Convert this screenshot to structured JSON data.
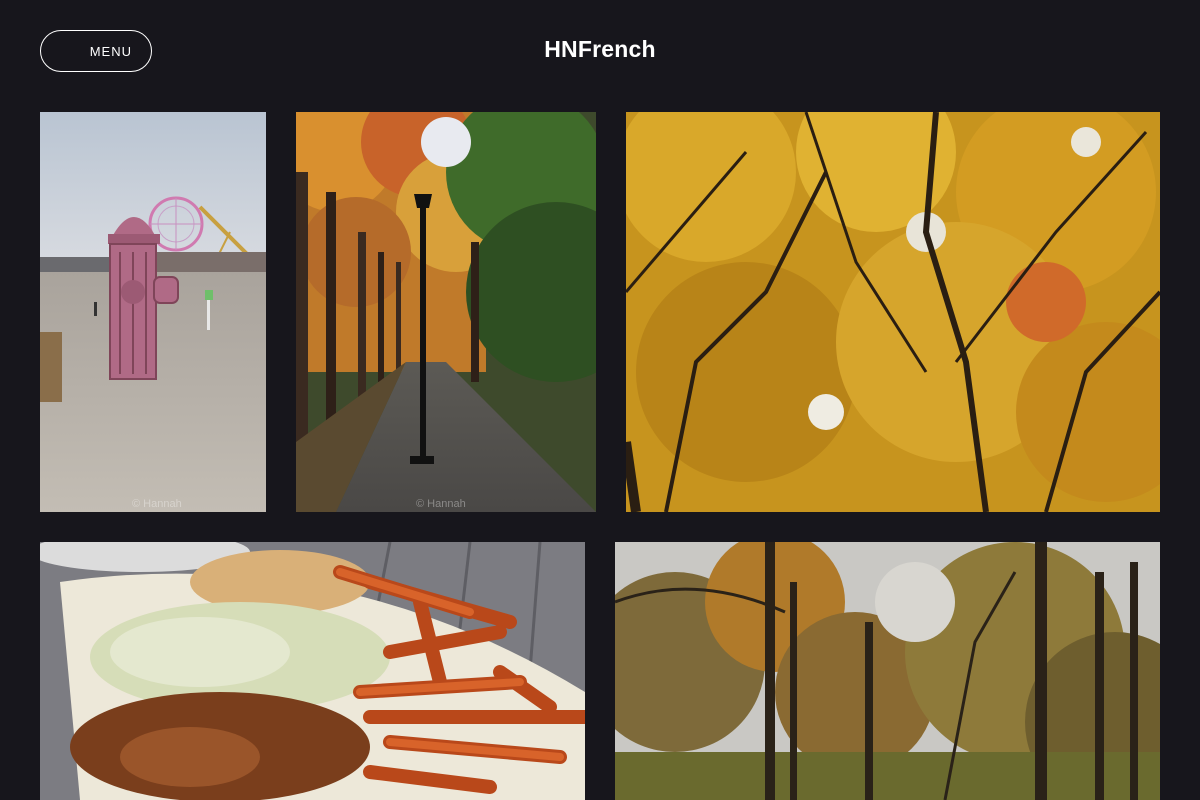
{
  "header": {
    "menu_label": "MENU",
    "site_title": "HNFrench"
  },
  "gallery": {
    "photos": [
      {
        "subject": "beach-fire-hydrant-ferris-wheel",
        "watermark": "© Hannah"
      },
      {
        "subject": "autumn-path-lamppost",
        "watermark": "© Hannah"
      },
      {
        "subject": "yellow-autumn-canopy",
        "watermark": ""
      },
      {
        "subject": "pulled-pork-sandwich-sweet-potato-fries",
        "watermark": ""
      },
      {
        "subject": "autumn-forest",
        "watermark": ""
      }
    ]
  },
  "colors": {
    "background": "#17161c",
    "text": "#ffffff"
  },
  "icons": {
    "menu": "hamburger-menu-icon"
  }
}
